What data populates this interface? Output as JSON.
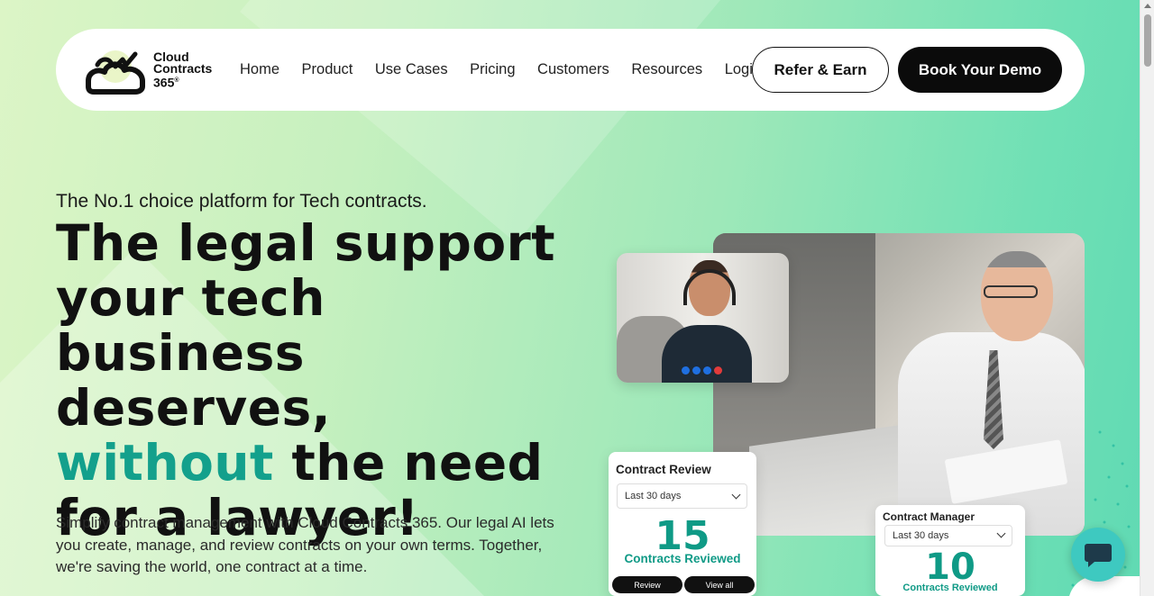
{
  "brand": {
    "logo_line1": "Cloud",
    "logo_line2": "Contracts",
    "logo_line3": "365",
    "logo_mark": "®"
  },
  "nav": {
    "links": [
      "Home",
      "Product",
      "Use Cases",
      "Pricing",
      "Customers",
      "Resources",
      "Login"
    ],
    "refer_label": "Refer & Earn",
    "demo_label": "Book Your Demo"
  },
  "hero": {
    "tagline": "The No.1 choice platform for Tech contracts.",
    "headline_part1": "The legal support your tech business deserves,",
    "headline_accent": "without",
    "headline_part2": "the need for a lawyer!",
    "subtext": "Simplify contract management with Cloud Contracts 365. Our legal AI lets you create, manage, and review contracts on your own terms. Together, we're saving the world, one contract at a time."
  },
  "cards": {
    "review": {
      "title": "Contract Review",
      "range": "Last 30 days",
      "value": "15",
      "label": "Contracts Reviewed",
      "btn_review": "Review",
      "btn_view_all": "View all"
    },
    "manager": {
      "title": "Contract Manager",
      "range": "Last 30 days",
      "value": "10",
      "label": "Contracts Reviewed"
    }
  },
  "icons": {
    "chat": "chat-icon",
    "chevron": "chevron-down-icon"
  },
  "colors": {
    "accent": "#13a08c",
    "dark_button": "#0b0b0b",
    "chat": "#3ec9c0"
  }
}
